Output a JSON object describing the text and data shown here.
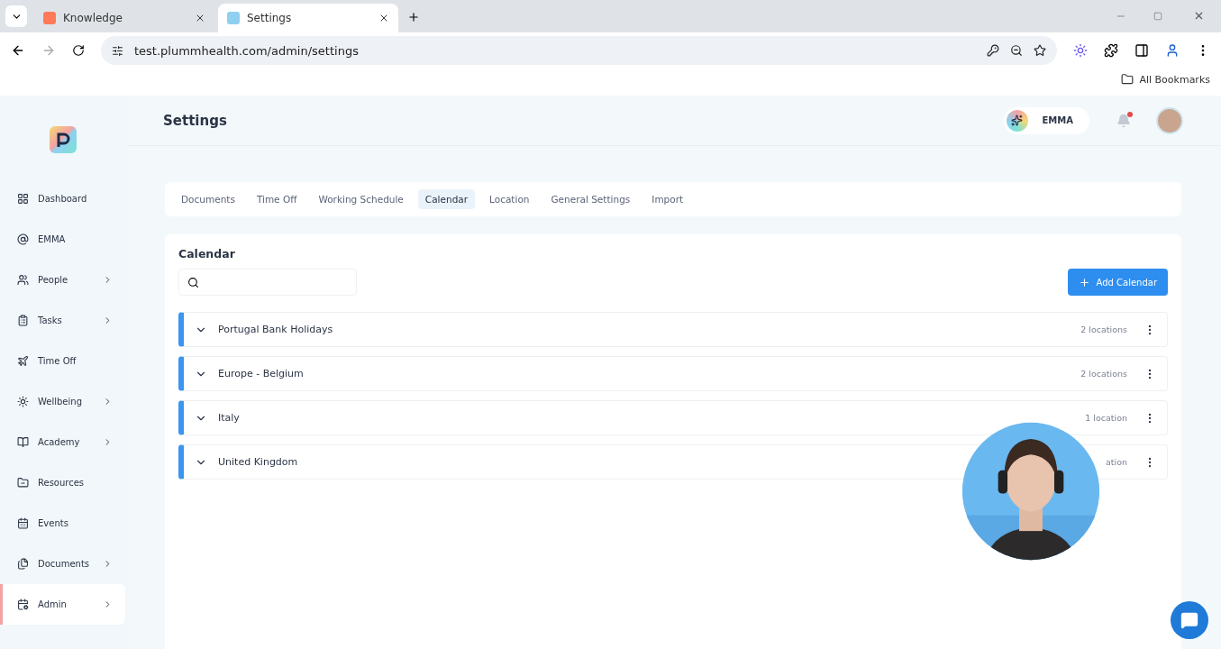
{
  "browser": {
    "tabs": [
      {
        "title": "Knowledge",
        "selected": false
      },
      {
        "title": "Settings",
        "selected": true
      }
    ],
    "url": "test.plummhealth.com/admin/settings",
    "bookmarks": "All Bookmarks"
  },
  "header": {
    "title": "Settings",
    "assistant": "EMMA",
    "unread_notifications": true
  },
  "sidebar": {
    "items": [
      {
        "label": "Dashboard",
        "submenu": false,
        "selected": false
      },
      {
        "label": "EMMA",
        "submenu": false,
        "selected": false
      },
      {
        "label": "People",
        "submenu": true,
        "selected": false
      },
      {
        "label": "Tasks",
        "submenu": true,
        "selected": false
      },
      {
        "label": "Time Off",
        "submenu": false,
        "selected": false
      },
      {
        "label": "Wellbeing",
        "submenu": true,
        "selected": false
      },
      {
        "label": "Academy",
        "submenu": true,
        "selected": false
      },
      {
        "label": "Resources",
        "submenu": false,
        "selected": false
      },
      {
        "label": "Events",
        "submenu": false,
        "selected": false
      },
      {
        "label": "Documents",
        "submenu": true,
        "selected": false
      },
      {
        "label": "Admin",
        "submenu": true,
        "selected": true
      }
    ]
  },
  "settings_tabs": [
    {
      "label": "Documents",
      "selected": false
    },
    {
      "label": "Time Off",
      "selected": false
    },
    {
      "label": "Working Schedule",
      "selected": false
    },
    {
      "label": "Calendar",
      "selected": true
    },
    {
      "label": "Location",
      "selected": false
    },
    {
      "label": "General Settings",
      "selected": false
    },
    {
      "label": "Import",
      "selected": false
    }
  ],
  "calendar": {
    "title": "Calendar",
    "add_button": "Add Calendar",
    "rows": [
      {
        "name": "Portugal Bank Holidays",
        "count": "2 locations",
        "expanded": false
      },
      {
        "name": "Europe - Belgium",
        "count": "2 locations",
        "expanded": false
      },
      {
        "name": "Italy",
        "count": "1 location",
        "expanded": false
      },
      {
        "name": "United Kingdom",
        "count": "ation",
        "expanded": false
      }
    ]
  }
}
